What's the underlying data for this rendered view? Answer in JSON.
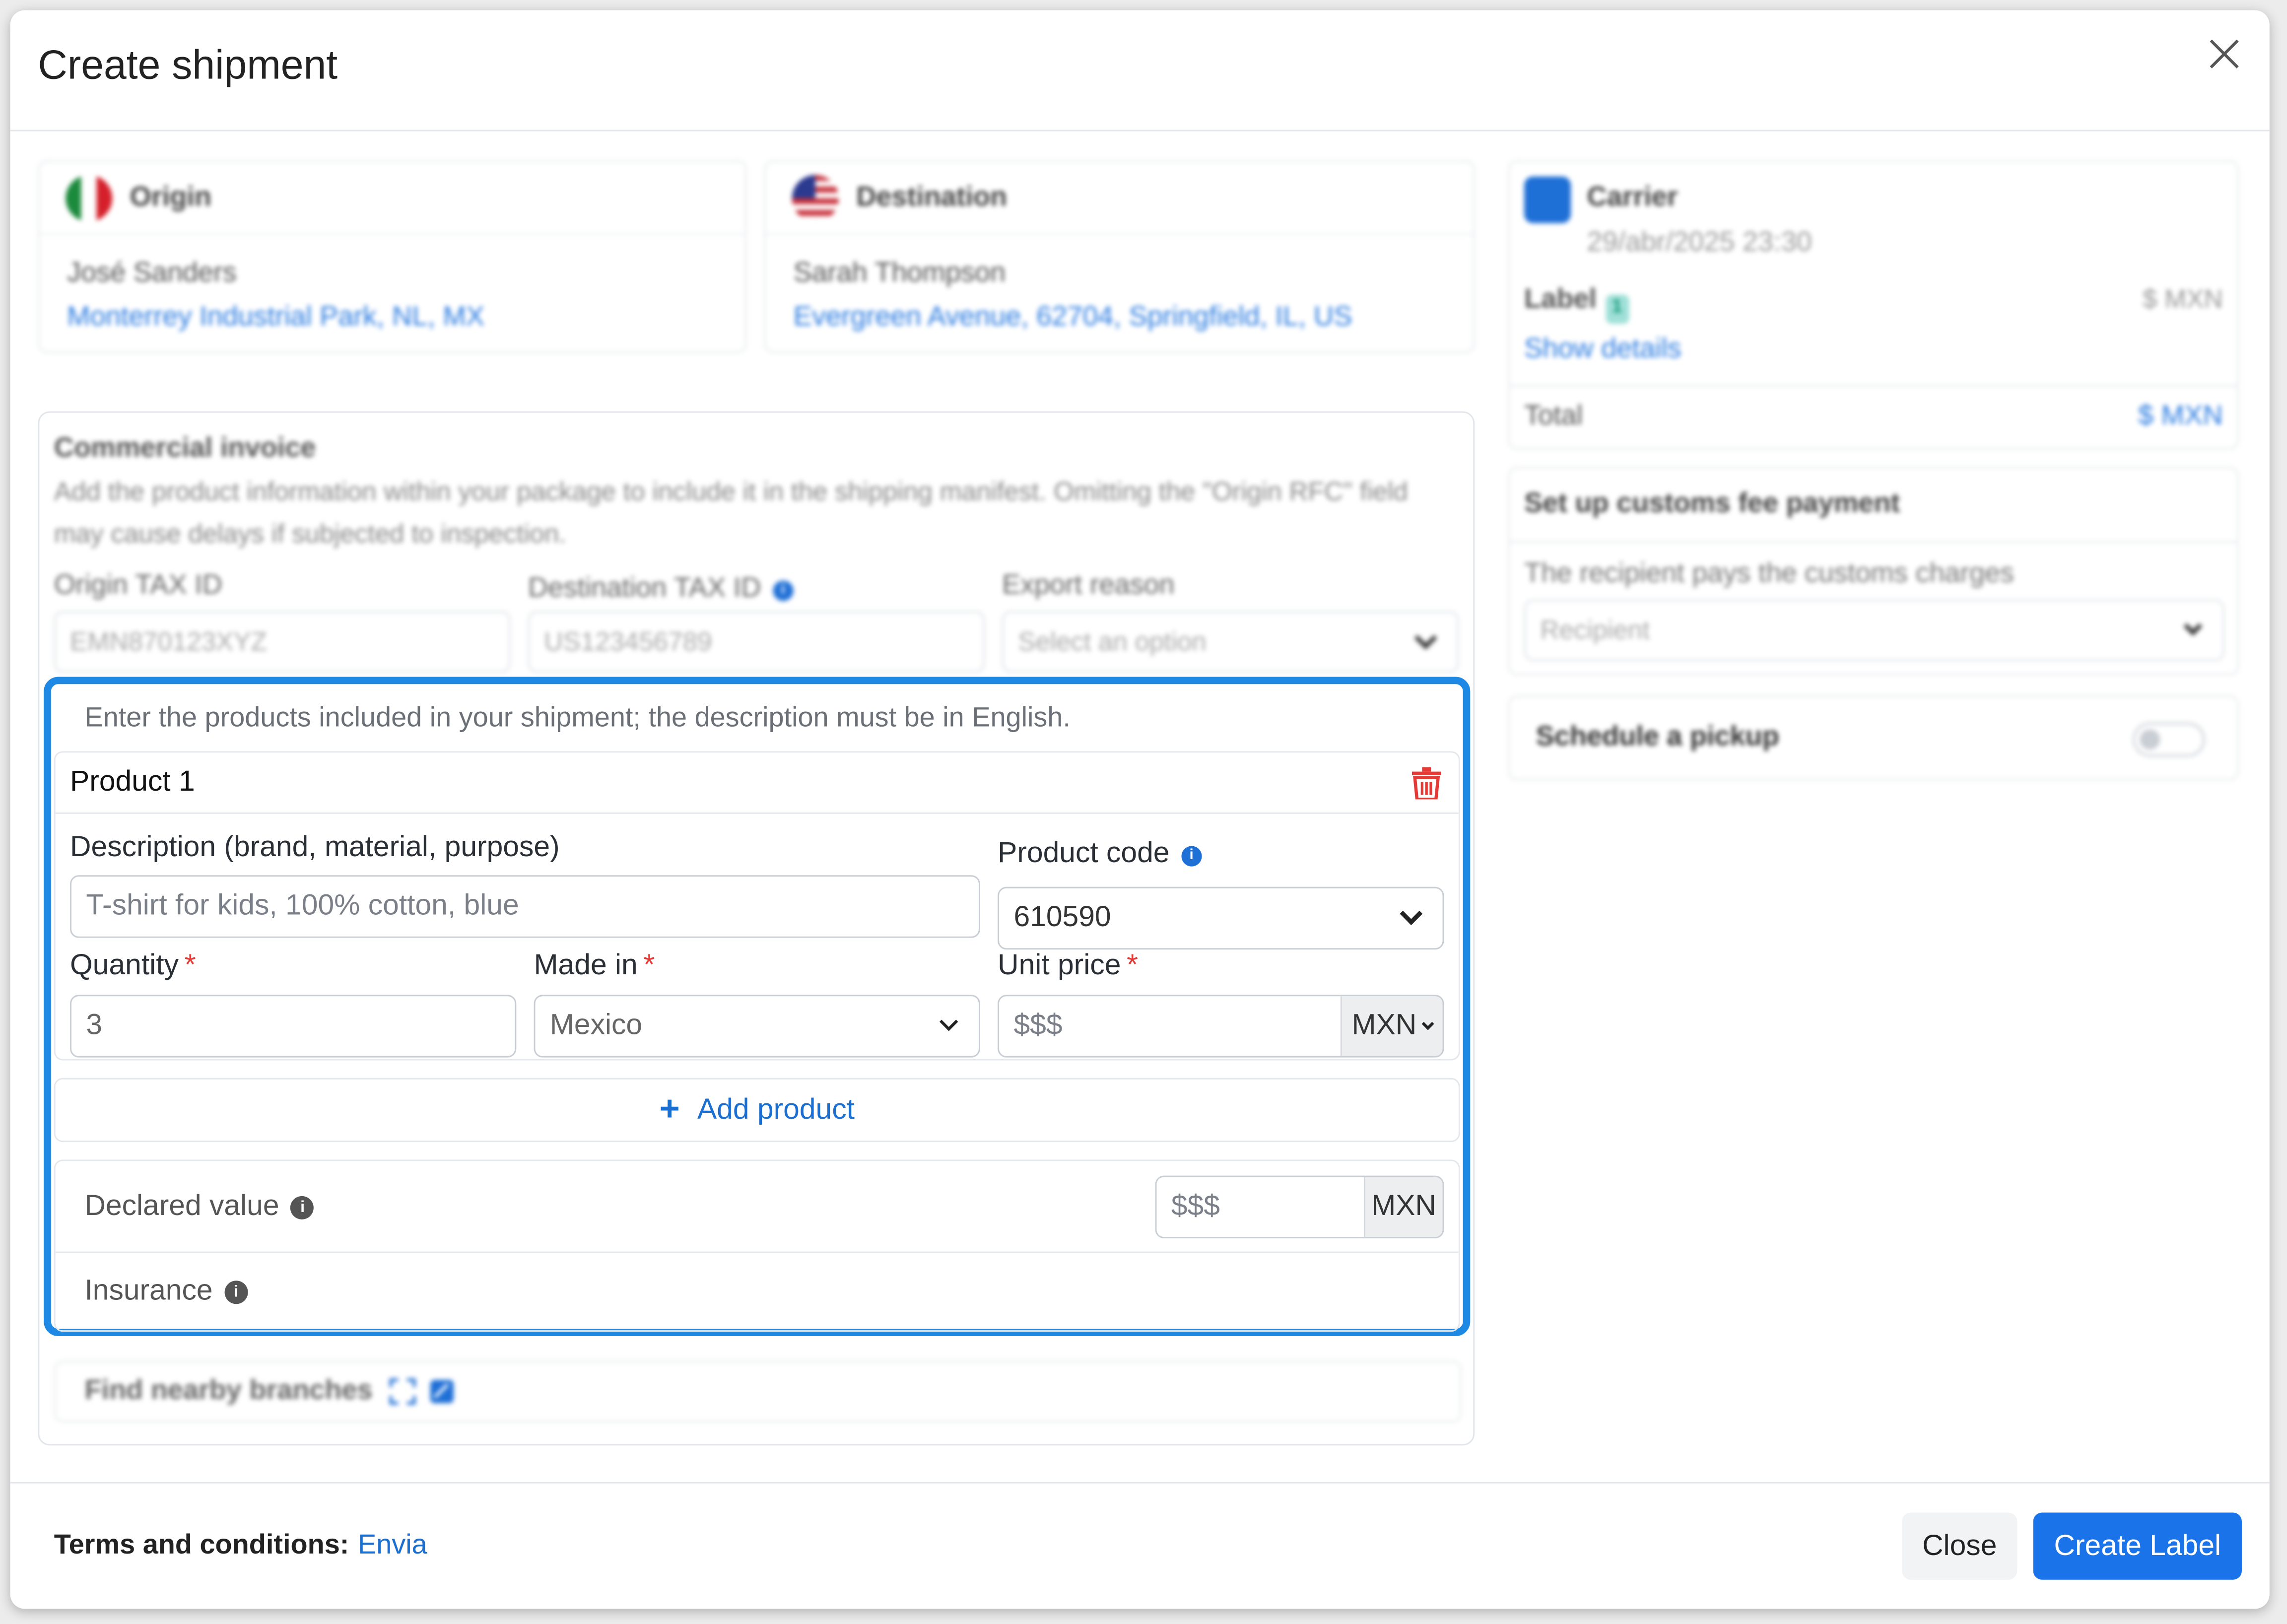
{
  "modal": {
    "title": "Create shipment"
  },
  "origin": {
    "heading": "Origin",
    "name": "José Sanders",
    "address": "Monterrey Industrial Park, NL, MX"
  },
  "destination": {
    "heading": "Destination",
    "name": "Sarah Thompson",
    "address": "Evergreen Avenue, 62704, Springfield, IL, US"
  },
  "invoice": {
    "title": "Commercial invoice",
    "description": "Add the product information within your package to include it in the shipping manifest. Omitting the \"Origin RFC\" field may cause delays if subjected to inspection.",
    "origin_tax_label": "Origin TAX ID",
    "origin_tax_value": "EMN870123XYZ",
    "dest_tax_label": "Destination TAX ID",
    "dest_tax_value": "US123456789",
    "export_reason_label": "Export reason",
    "export_reason_placeholder": "Select an option"
  },
  "products": {
    "hint": "Enter the products included in your shipment; the description must be in English.",
    "product_title": "Product 1",
    "description_label": "Description (brand, material, purpose)",
    "description_placeholder": "T-shirt for kids, 100% cotton, blue",
    "product_code_label": "Product code",
    "product_code_value": "610590",
    "quantity_label": "Quantity",
    "quantity_value": "3",
    "made_in_label": "Made in",
    "made_in_value": "Mexico",
    "unit_price_label": "Unit price",
    "unit_price_placeholder": "$$$",
    "unit_price_currency": "MXN",
    "required_mark": "*",
    "add_product_label": "Add product",
    "declared_value_label": "Declared value",
    "declared_value_placeholder": "$$$",
    "declared_value_currency": "MXN",
    "insurance_label": "Insurance"
  },
  "branches": {
    "label": "Find nearby branches"
  },
  "carrier": {
    "title": "Carrier",
    "datetime": "29/abr/2025 23:30",
    "label_text": "Label",
    "label_badge": "1",
    "label_amount": "$ MXN",
    "show_details": "Show details",
    "total_label": "Total",
    "total_value": "$ MXN"
  },
  "customs": {
    "title": "Set up customs fee payment",
    "text": "The recipient pays the customs charges",
    "select_value": "Recipient"
  },
  "pickup": {
    "title": "Schedule a pickup"
  },
  "footer": {
    "terms_label": "Terms and conditions:",
    "terms_link": "Envia",
    "close_label": "Close",
    "create_label": "Create Label"
  },
  "colors": {
    "accent": "#1a73e8",
    "focus_border": "#1e88e5",
    "required": "#e53935",
    "delete": "#e53935"
  }
}
